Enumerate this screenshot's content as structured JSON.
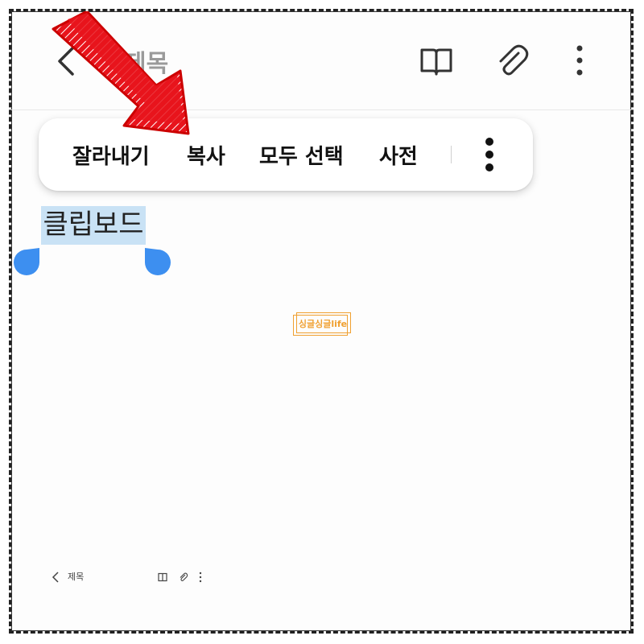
{
  "header": {
    "title": "제목",
    "back_icon": "chevron-left-icon",
    "reader_icon": "book-open-icon",
    "attach_icon": "paperclip-icon",
    "more_icon": "more-vertical-icon"
  },
  "context_menu": {
    "items": [
      {
        "label": "잘라내기"
      },
      {
        "label": "복사"
      },
      {
        "label": "모두 선택"
      },
      {
        "label": "사전"
      }
    ],
    "more_icon": "more-vertical-icon"
  },
  "editor": {
    "selected_text": "클립보드",
    "selection_color": "#c9e2f5",
    "handle_color": "#3d8ff0"
  },
  "watermark": {
    "text": "싱글싱글life",
    "color": "#f0a030"
  },
  "mini_preview": {
    "title": "제목"
  },
  "annotation": {
    "arrow_color": "#e8141c",
    "arrow_icon": "red-arrow-icon"
  }
}
